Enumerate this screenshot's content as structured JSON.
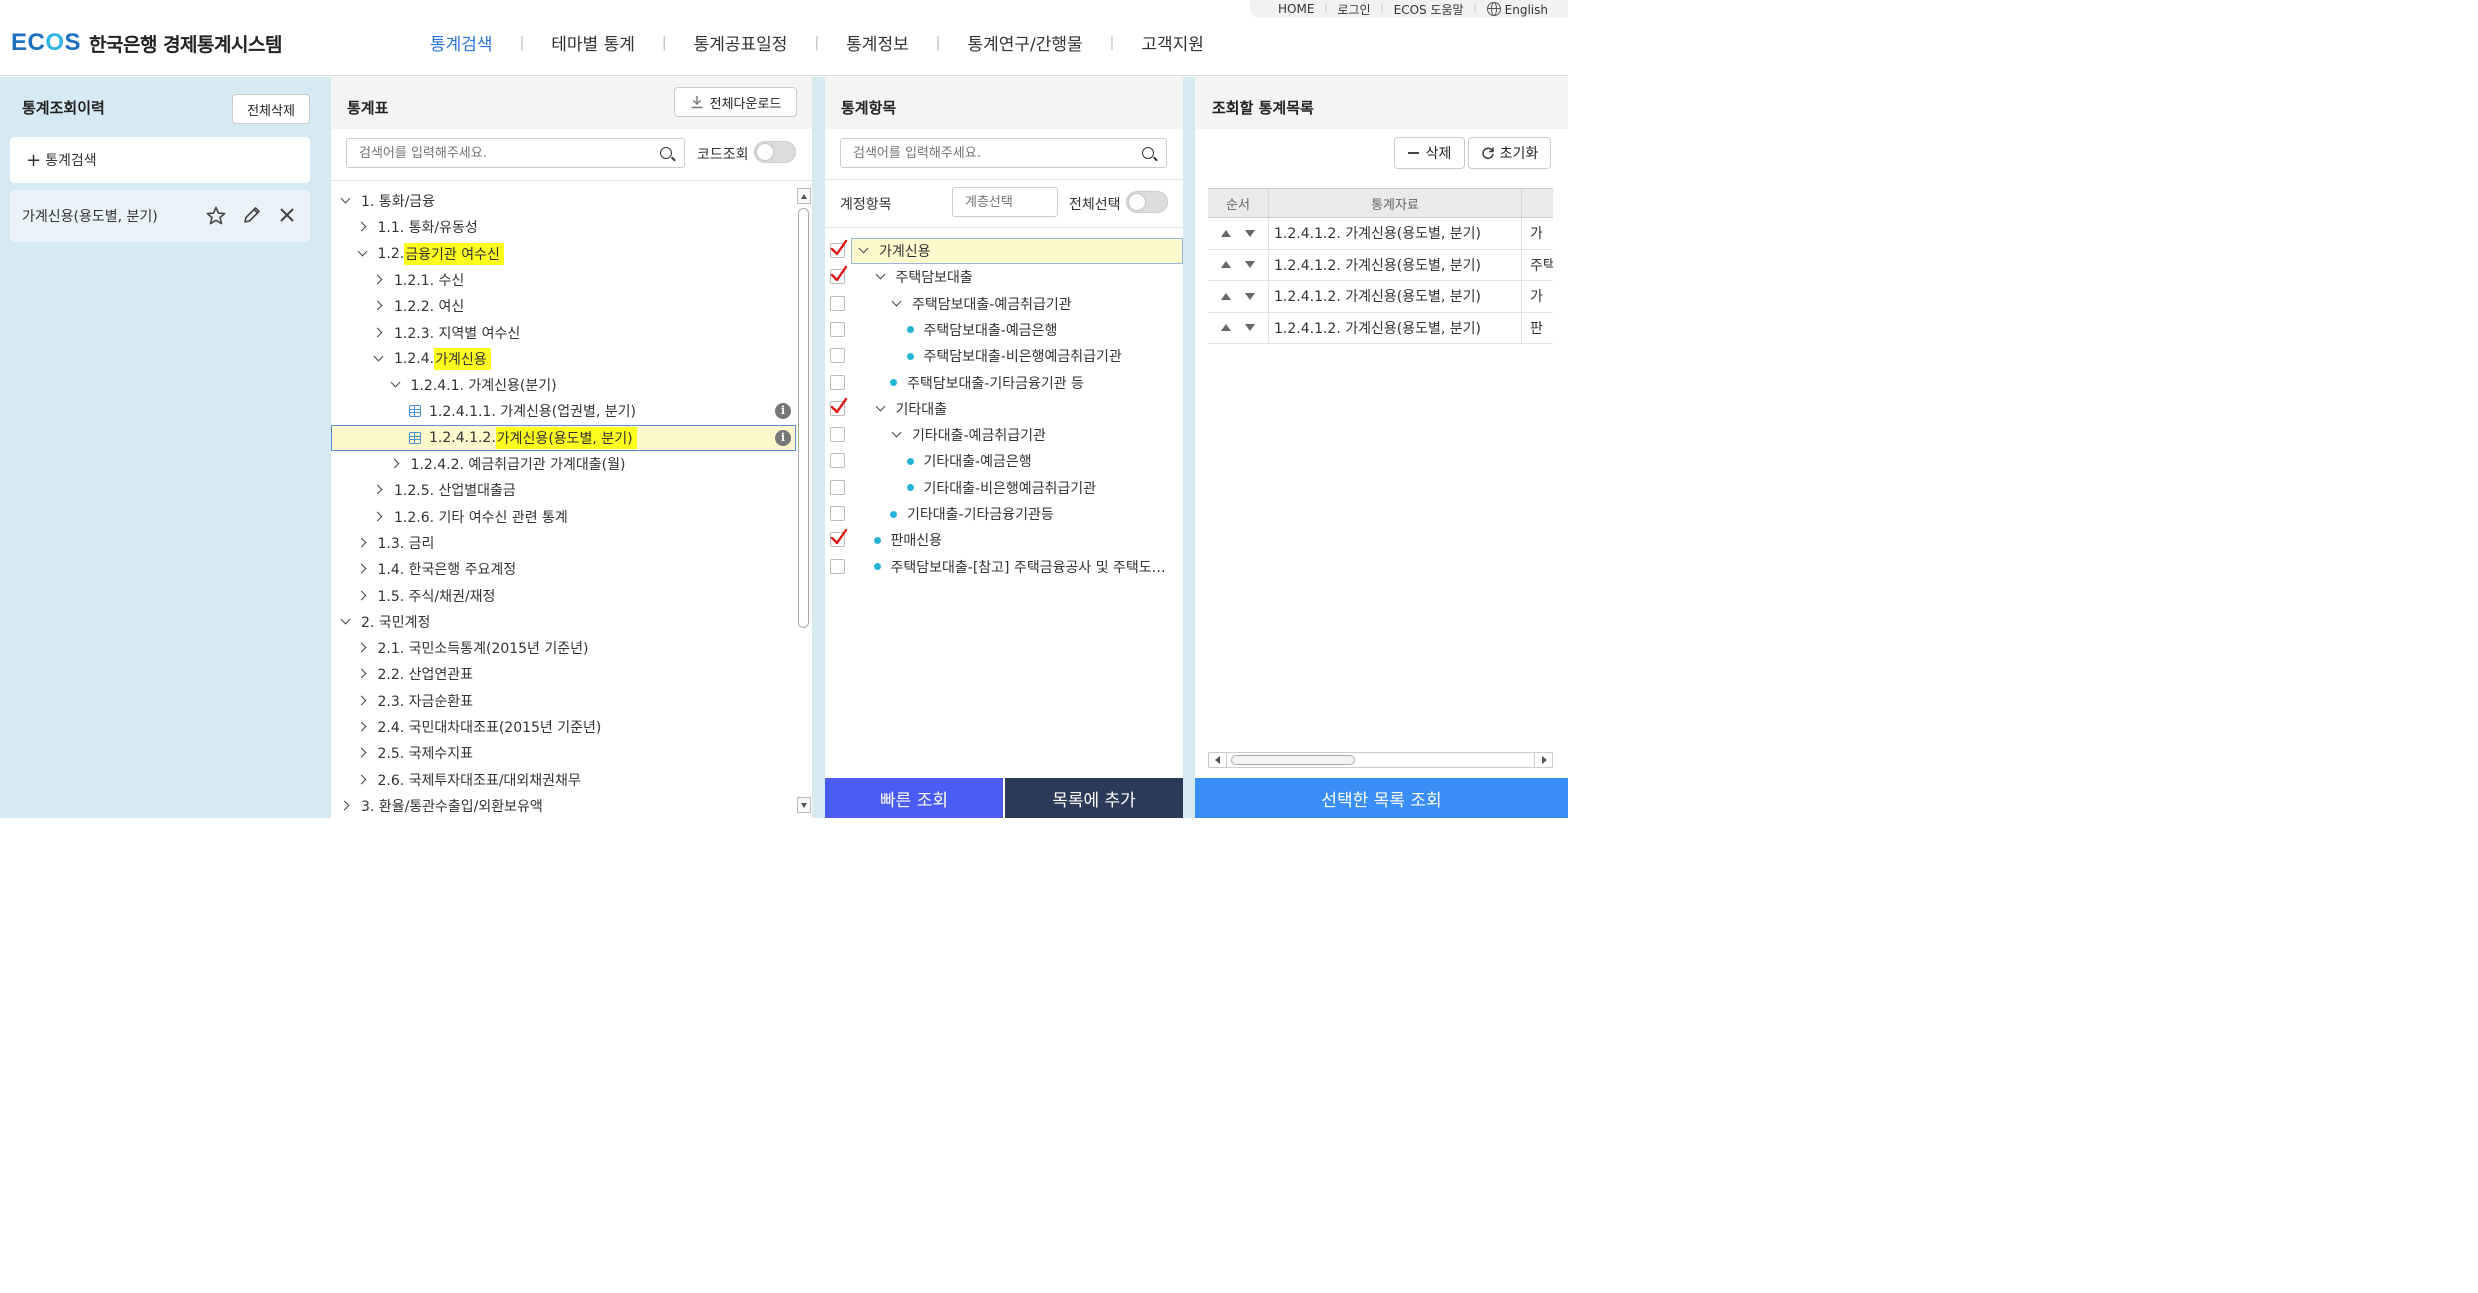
{
  "util": {
    "home": "HOME",
    "login": "로그인",
    "help": "ECOS 도움말",
    "lang": "English"
  },
  "logo": {
    "ecos_a": "EC",
    "ecos_b": "O",
    "ecos_c": "S",
    "name": "한국은행 경제통계시스템"
  },
  "gnb": [
    "통계검색",
    "테마별 통계",
    "통계공표일정",
    "통계정보",
    "통계연구/간행물",
    "고객지원"
  ],
  "history": {
    "title": "통계조회이력",
    "clear_all": "전체삭제",
    "add_search": "통계검색",
    "item": "가계신용(용도별, 분기)"
  },
  "table_panel": {
    "title": "통계표",
    "download_all": "전체다운로드",
    "search_placeholder": "검색어를 입력해주세요.",
    "code_label": "코드조회",
    "tree": [
      {
        "prefix": "1. 통화/금융",
        "hl": ""
      },
      {
        "prefix": "1.1. 통화/유동성",
        "hl": ""
      },
      {
        "prefix": "1.2. ",
        "hl": "금융기관 여수신"
      },
      {
        "prefix": "1.2.1. 수신",
        "hl": ""
      },
      {
        "prefix": "1.2.2. 여신",
        "hl": ""
      },
      {
        "prefix": "1.2.3. 지역별 여수신",
        "hl": ""
      },
      {
        "prefix": "1.2.4. ",
        "hl": "가계신용"
      },
      {
        "prefix": "1.2.4.1. 가계신용(분기)",
        "hl": ""
      },
      {
        "prefix": "1.2.4.1.1. 가계신용(업권별, 분기)",
        "hl": ""
      },
      {
        "prefix": "1.2.4.1.2. ",
        "hl": "가계신용(용도별, 분기)"
      },
      {
        "prefix": "1.2.4.2. 예금취급기관 가계대출(월)",
        "hl": ""
      },
      {
        "prefix": "1.2.5. 산업별대출금",
        "hl": ""
      },
      {
        "prefix": "1.2.6. 기타 여수신 관련 통계",
        "hl": ""
      },
      {
        "prefix": "1.3. 금리",
        "hl": ""
      },
      {
        "prefix": "1.4. 한국은행 주요계정",
        "hl": ""
      },
      {
        "prefix": "1.5. 주식/채권/재정",
        "hl": ""
      },
      {
        "prefix": "2. 국민계정",
        "hl": ""
      },
      {
        "prefix": "2.1. 국민소득통계(2015년 기준년)",
        "hl": ""
      },
      {
        "prefix": "2.2. 산업연관표",
        "hl": ""
      },
      {
        "prefix": "2.3. 자금순환표",
        "hl": ""
      },
      {
        "prefix": "2.4. 국민대차대조표(2015년 기준년)",
        "hl": ""
      },
      {
        "prefix": "2.5. 국제수지표",
        "hl": ""
      },
      {
        "prefix": "2.6. 국제투자대조표/대외채권채무",
        "hl": ""
      },
      {
        "prefix": "3. 환율/통관수출입/외환보유액",
        "hl": ""
      }
    ]
  },
  "items_panel": {
    "title": "통계항목",
    "search_placeholder": "검색어를 입력해주세요.",
    "account_label": "계정항목",
    "level_placeholder": "계층선택",
    "select_all": "전체선택",
    "items": [
      {
        "label": "가계신용",
        "checked": true
      },
      {
        "label": "주택담보대출",
        "checked": true
      },
      {
        "label": "주택담보대출-예금취급기관",
        "checked": false
      },
      {
        "label": "주택담보대출-예금은행",
        "checked": false
      },
      {
        "label": "주택담보대출-비은행예금취급기관",
        "checked": false
      },
      {
        "label": "주택담보대출-기타금융기관 등",
        "checked": false
      },
      {
        "label": "기타대출",
        "checked": true
      },
      {
        "label": "기타대출-예금취급기관",
        "checked": false
      },
      {
        "label": "기타대출-예금은행",
        "checked": false
      },
      {
        "label": "기타대출-비은행예금취급기관",
        "checked": false
      },
      {
        "label": "기타대출-기타금융기관등",
        "checked": false
      },
      {
        "label": "판매신용",
        "checked": true
      },
      {
        "label": "주택담보대출-[참고] 주택금융공사 및 주택도…",
        "checked": false
      }
    ],
    "quick_view": "빠른 조회",
    "add_to_list": "목록에 추가"
  },
  "list_panel": {
    "title": "조회할 통계목록",
    "delete": "삭제",
    "reset": "초기화",
    "col_order": "순서",
    "col_data": "통계자료",
    "rows": [
      {
        "data": "1.2.4.1.2. 가계신용(용도별, 분기)",
        "extra": "가"
      },
      {
        "data": "1.2.4.1.2. 가계신용(용도별, 분기)",
        "extra": "주택"
      },
      {
        "data": "1.2.4.1.2. 가계신용(용도별, 분기)",
        "extra": "가"
      },
      {
        "data": "1.2.4.1.2. 가계신용(용도별, 분기)",
        "extra": "판"
      }
    ],
    "view_selected": "선택한 목록 조회"
  },
  "colors": {
    "accent": "#2a74e2",
    "panel_bg": "#d6eaf4",
    "highlight": "#fefe1e",
    "quick_btn": "#4b5cf5",
    "add_btn": "#2c3a5a",
    "view_btn": "#3a8ef7",
    "dot": "#26b4d6"
  }
}
